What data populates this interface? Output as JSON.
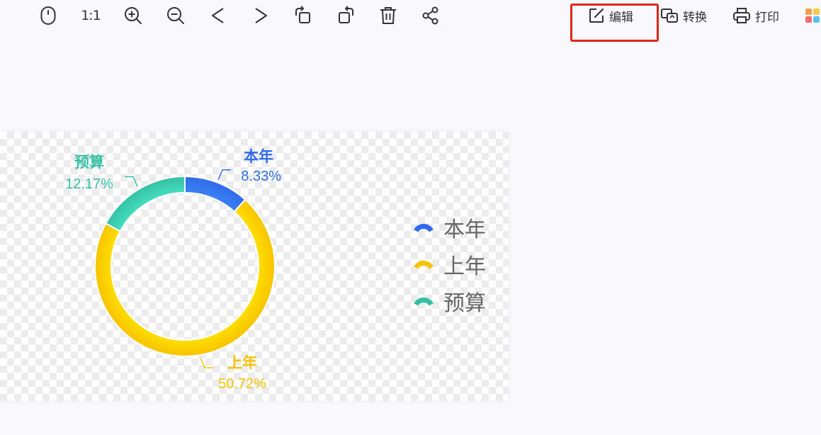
{
  "toolbar": {
    "icons": [
      "mouse-icon",
      "actual-size-icon",
      "zoom-in-icon",
      "zoom-out-icon",
      "previous-icon",
      "next-icon",
      "rotate-left-icon",
      "rotate-right-icon",
      "delete-icon",
      "share-icon"
    ],
    "actual_size_label": "1:1",
    "edit_label": "编辑",
    "convert_label": "转换",
    "print_label": "打印"
  },
  "chart_data": {
    "type": "pie",
    "categories": [
      "本年",
      "上年",
      "预算"
    ],
    "values": [
      8.33,
      50.72,
      12.17
    ],
    "labels": [
      "8.33%",
      "50.72%",
      "12.17%"
    ],
    "colors": [
      "#2f6bea",
      "#f7c300",
      "#35c0a4"
    ],
    "legend": [
      "本年",
      "上年",
      "预算"
    ],
    "legend_position": "right"
  }
}
